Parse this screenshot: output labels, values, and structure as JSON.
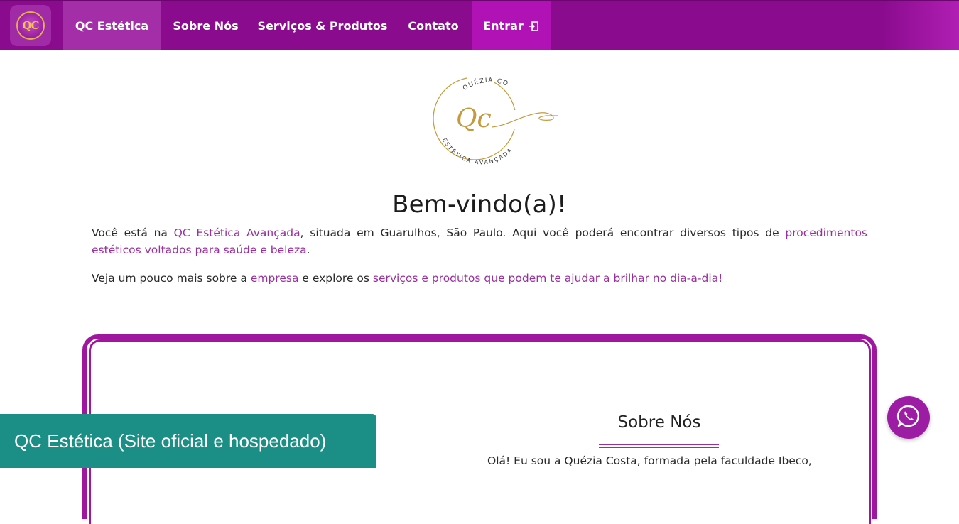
{
  "navbar": {
    "logo_text": "QC",
    "items": [
      {
        "label": "QC Estética"
      },
      {
        "label": "Sobre Nós"
      },
      {
        "label": "Serviços & Produtos"
      },
      {
        "label": "Contato"
      }
    ],
    "login_label": "Entrar"
  },
  "hero": {
    "logo_top_text": "QUÉZIA COSTA",
    "logo_monogram": "Qc",
    "logo_bottom_text": "ESTÉTICA AVANÇADA",
    "title": "Bem-vindo(a)!",
    "p1_a": "Você está na ",
    "p1_link1": "QC Estética Avançada",
    "p1_b": ", situada em Guarulhos, São Paulo. Aqui você poderá encontrar diversos tipos de ",
    "p1_link2": "procedimentos estéticos voltados para saúde e beleza",
    "p1_c": ".",
    "p2_a": "Veja um pouco mais sobre a ",
    "p2_link1": "empresa",
    "p2_b": " e explore os ",
    "p2_link2": "serviços e produtos que podem te ajudar a brilhar no dia-a-dia!"
  },
  "about": {
    "title": "Sobre Nós",
    "text": "Olá! Eu sou a Quézia Costa, formada pela faculdade Ibeco,"
  },
  "caption": "QC Estética (Site oficial e hospedado)",
  "colors": {
    "nav_bg": "#8a0b8e",
    "accent": "#9a2f9f",
    "caption_bg": "#1b8f86",
    "whatsapp_bg": "#9c1ca4"
  }
}
